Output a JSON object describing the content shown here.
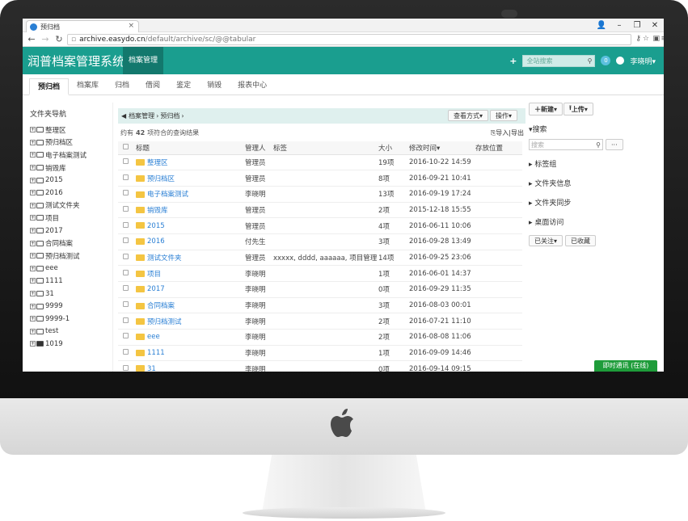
{
  "browser": {
    "tab_title": "预归档",
    "url_host": "archive.easydo.cn",
    "url_path": "/default/archive/sc/@@tabular"
  },
  "header": {
    "app_title": "润普档案管理系统",
    "nav_active": "档案管理",
    "search_placeholder": "全站搜索",
    "notif_count": "0",
    "user_name": "李晓明"
  },
  "tabs": [
    {
      "label": "预归档"
    },
    {
      "label": "档案库"
    },
    {
      "label": "归档"
    },
    {
      "label": "借阅"
    },
    {
      "label": "鉴定"
    },
    {
      "label": "销毁"
    },
    {
      "label": "报表中心"
    }
  ],
  "sidebar": {
    "title": "文件夹导航",
    "items": [
      {
        "label": "整理区"
      },
      {
        "label": "预归档区"
      },
      {
        "label": "电子档案测试"
      },
      {
        "label": "销毁库"
      },
      {
        "label": "2015"
      },
      {
        "label": "2016"
      },
      {
        "label": "测试文件夹"
      },
      {
        "label": "项目"
      },
      {
        "label": "2017"
      },
      {
        "label": "合同档案"
      },
      {
        "label": "预归档测试"
      },
      {
        "label": "eee"
      },
      {
        "label": "1111"
      },
      {
        "label": "31"
      },
      {
        "label": "9999"
      },
      {
        "label": "9999-1"
      },
      {
        "label": "test"
      },
      {
        "label": "1019"
      }
    ]
  },
  "breadcrumb": {
    "root": "档案管理",
    "current": "预归档",
    "view_button": "查看方式",
    "action_button": "操作"
  },
  "results": {
    "prefix": "约有",
    "count": "42",
    "suffix": "项符合的查询结果",
    "export": "导入|导出"
  },
  "table": {
    "columns": {
      "title": "标题",
      "manager": "管理人",
      "tags": "标签",
      "size": "大小",
      "modified": "修改时间",
      "location": "存放位置"
    },
    "rows": [
      {
        "title": "整理区",
        "manager": "管理员",
        "tags": "",
        "size": "19项",
        "modified": "2016-10-22 14:59"
      },
      {
        "title": "预归档区",
        "manager": "管理员",
        "tags": "",
        "size": "8项",
        "modified": "2016-09-21 10:41"
      },
      {
        "title": "电子档案测试",
        "manager": "李晓明",
        "tags": "",
        "size": "13项",
        "modified": "2016-09-19 17:24"
      },
      {
        "title": "销毁库",
        "manager": "管理员",
        "tags": "",
        "size": "2项",
        "modified": "2015-12-18 15:55"
      },
      {
        "title": "2015",
        "manager": "管理员",
        "tags": "",
        "size": "4项",
        "modified": "2016-06-11 10:06"
      },
      {
        "title": "2016",
        "manager": "付先生",
        "tags": "",
        "size": "3项",
        "modified": "2016-09-28 13:49"
      },
      {
        "title": "测试文件夹",
        "manager": "管理员",
        "tags": "xxxxx, dddd, aaaaaa, 项目管理",
        "size": "14项",
        "modified": "2016-09-25 23:06"
      },
      {
        "title": "项目",
        "manager": "李晓明",
        "tags": "",
        "size": "1项",
        "modified": "2016-06-01 14:37"
      },
      {
        "title": "2017",
        "manager": "李晓明",
        "tags": "",
        "size": "0项",
        "modified": "2016-09-29 11:35"
      },
      {
        "title": "合同档案",
        "manager": "李晓明",
        "tags": "",
        "size": "3项",
        "modified": "2016-08-03 00:01"
      },
      {
        "title": "预归档测试",
        "manager": "李晓明",
        "tags": "",
        "size": "2项",
        "modified": "2016-07-21 11:10"
      },
      {
        "title": "eee",
        "manager": "李晓明",
        "tags": "",
        "size": "2项",
        "modified": "2016-08-08 11:06"
      },
      {
        "title": "1111",
        "manager": "李晓明",
        "tags": "",
        "size": "1项",
        "modified": "2016-09-09 14:46"
      },
      {
        "title": "31",
        "manager": "李晓明",
        "tags": "",
        "size": "0项",
        "modified": "2016-09-14 09:15"
      }
    ]
  },
  "right_panel": {
    "new_button": "新建",
    "upload_button": "上传",
    "search_heading": "搜索",
    "search_placeholder": "搜索",
    "more_button": "···",
    "sections": [
      {
        "label": "标签组"
      },
      {
        "label": "文件夹信息"
      },
      {
        "label": "文件夹同步"
      },
      {
        "label": "桌面访问"
      }
    ],
    "followed_button": "已关注",
    "favorited_button": "已收藏"
  },
  "im_button": "即时通讯 (在线)"
}
